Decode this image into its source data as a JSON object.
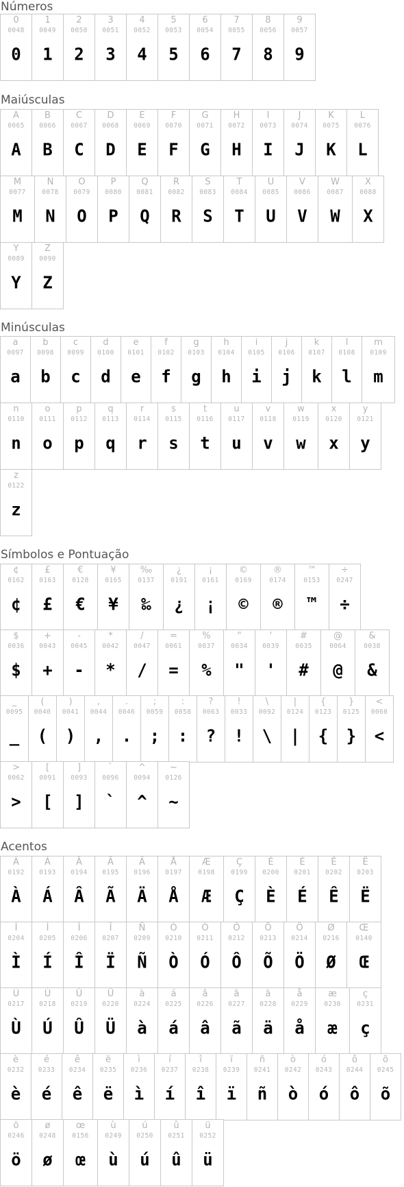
{
  "sections": [
    {
      "title": "Números",
      "rows": [
        [
          [
            "0",
            "0048"
          ],
          [
            "1",
            "0049"
          ],
          [
            "2",
            "0050"
          ],
          [
            "3",
            "0051"
          ],
          [
            "4",
            "0052"
          ],
          [
            "5",
            "0053"
          ],
          [
            "6",
            "0054"
          ],
          [
            "7",
            "0055"
          ],
          [
            "8",
            "0056"
          ],
          [
            "9",
            "0057"
          ]
        ]
      ]
    },
    {
      "title": "Maiúsculas",
      "rows": [
        [
          [
            "A",
            "0065"
          ],
          [
            "B",
            "0066"
          ],
          [
            "C",
            "0067"
          ],
          [
            "D",
            "0068"
          ],
          [
            "E",
            "0069"
          ],
          [
            "F",
            "0070"
          ],
          [
            "G",
            "0071"
          ],
          [
            "H",
            "0072"
          ],
          [
            "I",
            "0073"
          ],
          [
            "J",
            "0074"
          ],
          [
            "K",
            "0075"
          ],
          [
            "L",
            "0076"
          ]
        ],
        [
          [
            "M",
            "0077"
          ],
          [
            "N",
            "0078"
          ],
          [
            "O",
            "0079"
          ],
          [
            "P",
            "0080"
          ],
          [
            "Q",
            "0081"
          ],
          [
            "R",
            "0082"
          ],
          [
            "S",
            "0083"
          ],
          [
            "T",
            "0084"
          ],
          [
            "U",
            "0085"
          ],
          [
            "V",
            "0086"
          ],
          [
            "W",
            "0087"
          ],
          [
            "X",
            "0088"
          ]
        ],
        [
          [
            "Y",
            "0089"
          ],
          [
            "Z",
            "0090"
          ]
        ]
      ]
    },
    {
      "title": "Minúsculas",
      "rows": [
        [
          [
            "a",
            "0097"
          ],
          [
            "b",
            "0098"
          ],
          [
            "c",
            "0099"
          ],
          [
            "d",
            "0100"
          ],
          [
            "e",
            "0101"
          ],
          [
            "f",
            "0102"
          ],
          [
            "g",
            "0103"
          ],
          [
            "h",
            "0104"
          ],
          [
            "i",
            "0105"
          ],
          [
            "j",
            "0106"
          ],
          [
            "k",
            "0107"
          ],
          [
            "l",
            "0108"
          ],
          [
            "m",
            "0109"
          ]
        ],
        [
          [
            "n",
            "0110"
          ],
          [
            "o",
            "0111"
          ],
          [
            "p",
            "0112"
          ],
          [
            "q",
            "0113"
          ],
          [
            "r",
            "0114"
          ],
          [
            "s",
            "0115"
          ],
          [
            "t",
            "0116"
          ],
          [
            "u",
            "0117"
          ],
          [
            "v",
            "0118"
          ],
          [
            "w",
            "0119"
          ],
          [
            "x",
            "0120"
          ],
          [
            "y",
            "0121"
          ]
        ],
        [
          [
            "z",
            "0122"
          ]
        ]
      ]
    },
    {
      "title": "Símbolos e Pontuação",
      "rows": [
        [
          [
            "¢",
            "0162"
          ],
          [
            "£",
            "0163"
          ],
          [
            "€",
            "0128"
          ],
          [
            "¥",
            "0165"
          ],
          [
            "‰",
            "0137"
          ],
          [
            "¿",
            "0191"
          ],
          [
            "¡",
            "0161"
          ],
          [
            "©",
            "0169"
          ],
          [
            "®",
            "0174"
          ],
          [
            "™",
            "0153"
          ],
          [
            "÷",
            "0247"
          ]
        ],
        [
          [
            "$",
            "0036"
          ],
          [
            "+",
            "0043"
          ],
          [
            "-",
            "0045"
          ],
          [
            "*",
            "0042"
          ],
          [
            "/",
            "0047"
          ],
          [
            "=",
            "0061"
          ],
          [
            "%",
            "0037"
          ],
          [
            "\"",
            "0034"
          ],
          [
            "'",
            "0039"
          ],
          [
            "#",
            "0035"
          ],
          [
            "@",
            "0064"
          ],
          [
            "&",
            "0038"
          ]
        ],
        [
          [
            "_",
            "0095"
          ],
          [
            "(",
            "0040"
          ],
          [
            ")",
            "0041"
          ],
          [
            ",",
            "0044"
          ],
          [
            ".",
            "0046"
          ],
          [
            ";",
            "0059"
          ],
          [
            ":",
            "0058"
          ],
          [
            "?",
            "0063"
          ],
          [
            "!",
            "0033"
          ],
          [
            "\\",
            "0092"
          ],
          [
            "|",
            "0124"
          ],
          [
            "{",
            "0123"
          ],
          [
            "}",
            "0125"
          ],
          [
            "<",
            "0060"
          ]
        ],
        [
          [
            ">",
            "0062"
          ],
          [
            "[",
            "0091"
          ],
          [
            "]",
            "0093"
          ],
          [
            "`",
            "0096"
          ],
          [
            "^",
            "0094"
          ],
          [
            "~",
            "0126"
          ]
        ]
      ]
    },
    {
      "title": "Acentos",
      "rows": [
        [
          [
            "À",
            "0192"
          ],
          [
            "Á",
            "0193"
          ],
          [
            "Â",
            "0194"
          ],
          [
            "Ã",
            "0195"
          ],
          [
            "Ä",
            "0196"
          ],
          [
            "Å",
            "0197"
          ],
          [
            "Æ",
            "0198"
          ],
          [
            "Ç",
            "0199"
          ],
          [
            "È",
            "0200"
          ],
          [
            "É",
            "0201"
          ],
          [
            "Ê",
            "0202"
          ],
          [
            "Ë",
            "0203"
          ]
        ],
        [
          [
            "Ì",
            "0204"
          ],
          [
            "Í",
            "0205"
          ],
          [
            "Î",
            "0206"
          ],
          [
            "Ï",
            "0207"
          ],
          [
            "Ñ",
            "0209"
          ],
          [
            "Ò",
            "0210"
          ],
          [
            "Ó",
            "0211"
          ],
          [
            "Ô",
            "0212"
          ],
          [
            "Õ",
            "0213"
          ],
          [
            "Ö",
            "0214"
          ],
          [
            "Ø",
            "0216"
          ],
          [
            "Œ",
            "0140"
          ]
        ],
        [
          [
            "Ù",
            "0217"
          ],
          [
            "Ú",
            "0218"
          ],
          [
            "Û",
            "0219"
          ],
          [
            "Ü",
            "0220"
          ],
          [
            "à",
            "0224"
          ],
          [
            "á",
            "0225"
          ],
          [
            "â",
            "0226"
          ],
          [
            "ã",
            "0227"
          ],
          [
            "ä",
            "0228"
          ],
          [
            "å",
            "0229"
          ],
          [
            "æ",
            "0230"
          ],
          [
            "ç",
            "0231"
          ]
        ],
        [
          [
            "è",
            "0232"
          ],
          [
            "é",
            "0233"
          ],
          [
            "ê",
            "0234"
          ],
          [
            "ë",
            "0235"
          ],
          [
            "ì",
            "0236"
          ],
          [
            "í",
            "0237"
          ],
          [
            "î",
            "0238"
          ],
          [
            "ï",
            "0239"
          ],
          [
            "ñ",
            "0241"
          ],
          [
            "ò",
            "0242"
          ],
          [
            "ó",
            "0243"
          ],
          [
            "ô",
            "0244"
          ],
          [
            "õ",
            "0245"
          ]
        ],
        [
          [
            "ö",
            "0246"
          ],
          [
            "ø",
            "0248"
          ],
          [
            "œ",
            "0156"
          ],
          [
            "ù",
            "0249"
          ],
          [
            "ú",
            "0250"
          ],
          [
            "û",
            "0251"
          ],
          [
            "ü",
            "0252"
          ]
        ]
      ]
    }
  ]
}
